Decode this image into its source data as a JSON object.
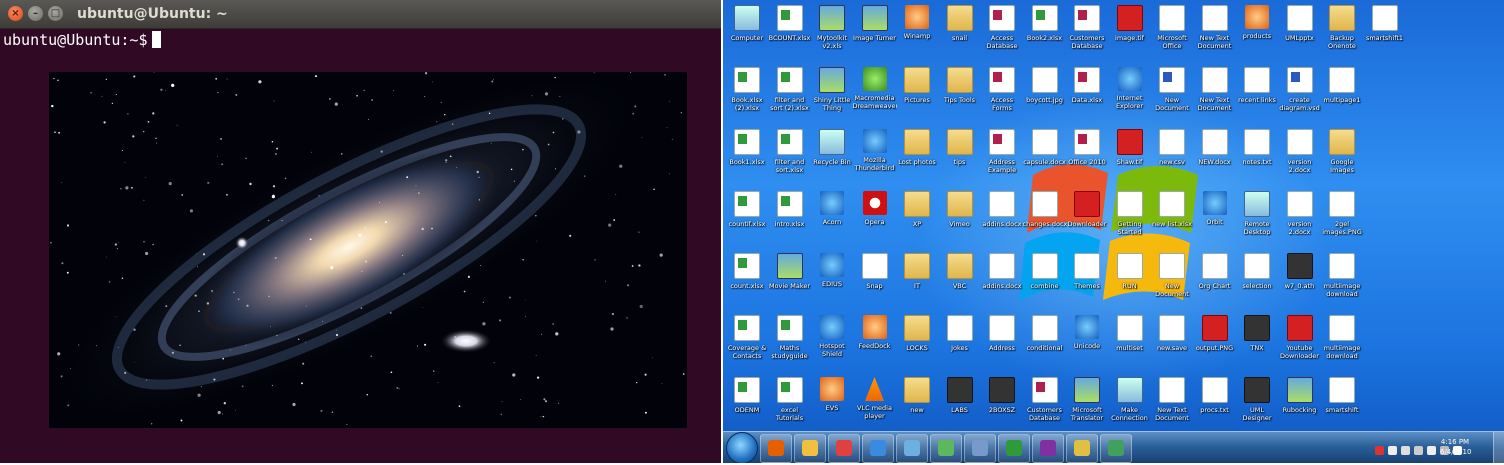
{
  "terminal": {
    "title": "ubuntu@Ubuntu: ~",
    "prompt": "ubuntu@Ubuntu:~$",
    "controls": {
      "close": "×",
      "minimize": "–",
      "maximize": "□"
    }
  },
  "desktop": {
    "icons": [
      {
        "label": "Computer",
        "kind": "g-win"
      },
      {
        "label": "BCOUNT.xlsx",
        "kind": "g-xls"
      },
      {
        "label": "Mytoolkit v2.xls",
        "kind": "g-img"
      },
      {
        "label": "Image Turner",
        "kind": "g-img"
      },
      {
        "label": "Winamp",
        "kind": "g-orange"
      },
      {
        "label": "snail",
        "kind": "g-fold"
      },
      {
        "label": "Access Database",
        "kind": "g-acc"
      },
      {
        "label": "Book2.xlsx",
        "kind": "g-xls"
      },
      {
        "label": "Customers Database",
        "kind": "g-acc"
      },
      {
        "label": "image.tif",
        "kind": "g-red"
      },
      {
        "label": "Microsoft Office",
        "kind": "g-doc"
      },
      {
        "label": "New Text Document",
        "kind": "g-doc"
      },
      {
        "label": "products",
        "kind": "g-orange"
      },
      {
        "label": "UMLpptx",
        "kind": "g-doc"
      },
      {
        "label": "Backup Onenote",
        "kind": "g-fold"
      },
      {
        "label": "smartshift1",
        "kind": "g-doc"
      },
      {
        "label": "Book.xlsx (2).xlsx",
        "kind": "g-xls"
      },
      {
        "label": "filter and sort (2).xlsx",
        "kind": "g-xls"
      },
      {
        "label": "Shiny Little Thing",
        "kind": "g-img"
      },
      {
        "label": "Macromedia Dreamweaver",
        "kind": "g-green"
      },
      {
        "label": "Pictures",
        "kind": "g-fold"
      },
      {
        "label": "Tips Tools",
        "kind": "g-fold"
      },
      {
        "label": "Access Forms",
        "kind": "g-acc"
      },
      {
        "label": "boycott.jpg",
        "kind": "g-doc"
      },
      {
        "label": "Data.xlsx",
        "kind": "g-acc"
      },
      {
        "label": "Internet Explorer",
        "kind": "g-blue"
      },
      {
        "label": "New Document",
        "kind": "g-wrd"
      },
      {
        "label": "New Text Document",
        "kind": "g-doc"
      },
      {
        "label": "recent links",
        "kind": "g-doc"
      },
      {
        "label": "create diagram.vsd",
        "kind": "g-wrd"
      },
      {
        "label": "multipage1",
        "kind": "g-doc"
      },
      {
        "label": "Book1.xlsx",
        "kind": "g-xls"
      },
      {
        "label": "filter and sort.xlsx",
        "kind": "g-xls"
      },
      {
        "label": "Recycle Bin",
        "kind": "g-win"
      },
      {
        "label": "Mozilla Thunderbird",
        "kind": "g-blue"
      },
      {
        "label": "Lost photos",
        "kind": "g-fold"
      },
      {
        "label": "tips",
        "kind": "g-fold"
      },
      {
        "label": "Address Example",
        "kind": "g-acc"
      },
      {
        "label": "capsule.docx",
        "kind": "g-doc"
      },
      {
        "label": "Office 2010",
        "kind": "g-acc"
      },
      {
        "label": "Shaw.tif",
        "kind": "g-red"
      },
      {
        "label": "new.csv",
        "kind": "g-doc"
      },
      {
        "label": "NEW.docx",
        "kind": "g-doc"
      },
      {
        "label": "notes.txt",
        "kind": "g-doc"
      },
      {
        "label": "version 2.docx",
        "kind": "g-doc"
      },
      {
        "label": "Google Images",
        "kind": "g-fold"
      },
      {
        "label": "countif.xlsx",
        "kind": "g-xls"
      },
      {
        "label": "intro.xlsx",
        "kind": "g-xls"
      },
      {
        "label": "Acorn",
        "kind": "g-blue"
      },
      {
        "label": "Opera",
        "kind": "g-opera"
      },
      {
        "label": "XP",
        "kind": "g-fold"
      },
      {
        "label": "Vimeo",
        "kind": "g-fold"
      },
      {
        "label": "addins.docx",
        "kind": "g-doc"
      },
      {
        "label": "changes.docx",
        "kind": "g-doc"
      },
      {
        "label": "Downloader",
        "kind": "g-red"
      },
      {
        "label": "Getting Started",
        "kind": "g-doc"
      },
      {
        "label": "new list.xlsx",
        "kind": "g-doc"
      },
      {
        "label": "Orbit",
        "kind": "g-blue"
      },
      {
        "label": "Remote Desktop",
        "kind": "g-win"
      },
      {
        "label": "version 2.docx",
        "kind": "g-doc"
      },
      {
        "label": "2gel images.PNG",
        "kind": "g-doc"
      },
      {
        "label": "count.xlsx",
        "kind": "g-xls"
      },
      {
        "label": "Movie Maker",
        "kind": "g-img"
      },
      {
        "label": "EDIUS",
        "kind": "g-blue"
      },
      {
        "label": "Snap",
        "kind": "g-doc"
      },
      {
        "label": "IT",
        "kind": "g-fold"
      },
      {
        "label": "VBC",
        "kind": "g-fold"
      },
      {
        "label": "addins.docx",
        "kind": "g-doc"
      },
      {
        "label": "combine",
        "kind": "g-doc"
      },
      {
        "label": "Themes",
        "kind": "g-doc"
      },
      {
        "label": "RUN",
        "kind": "g-doc"
      },
      {
        "label": "New Document",
        "kind": "g-doc"
      },
      {
        "label": "Org Chart",
        "kind": "g-doc"
      },
      {
        "label": "selection",
        "kind": "g-doc"
      },
      {
        "label": "w7_0.ath",
        "kind": "g-dark"
      },
      {
        "label": "multiimage download",
        "kind": "g-doc"
      },
      {
        "label": "Coverage & Contacts",
        "kind": "g-xls"
      },
      {
        "label": "Maths studyguide",
        "kind": "g-xls"
      },
      {
        "label": "Hotspot Shield",
        "kind": "g-blue"
      },
      {
        "label": "FeedDock",
        "kind": "g-orange"
      },
      {
        "label": "LOCKS",
        "kind": "g-fold"
      },
      {
        "label": "Jokes",
        "kind": "g-doc"
      },
      {
        "label": "Address",
        "kind": "g-doc"
      },
      {
        "label": "conditional",
        "kind": "g-doc"
      },
      {
        "label": "Unicode",
        "kind": "g-blue"
      },
      {
        "label": "multiset",
        "kind": "g-doc"
      },
      {
        "label": "new.save",
        "kind": "g-doc"
      },
      {
        "label": "output.PNG",
        "kind": "g-red"
      },
      {
        "label": "TNX",
        "kind": "g-dark"
      },
      {
        "label": "Youtube Downloader",
        "kind": "g-red"
      },
      {
        "label": "multiimage download",
        "kind": "g-doc"
      },
      {
        "label": "ODENM",
        "kind": "g-xls"
      },
      {
        "label": "excel Tutorials",
        "kind": "g-xls"
      },
      {
        "label": "EVS",
        "kind": "g-orange"
      },
      {
        "label": "VLC media player",
        "kind": "g-cone"
      },
      {
        "label": "new",
        "kind": "g-fold"
      },
      {
        "label": "LABS",
        "kind": "g-dark"
      },
      {
        "label": "2BOXSZ",
        "kind": "g-dark"
      },
      {
        "label": "Customers Database",
        "kind": "g-acc"
      },
      {
        "label": "Microsoft Translator",
        "kind": "g-img"
      },
      {
        "label": "Make Connection",
        "kind": "g-win"
      },
      {
        "label": "New Text Document",
        "kind": "g-doc"
      },
      {
        "label": "procs.txt",
        "kind": "g-doc"
      },
      {
        "label": "UML Designer",
        "kind": "g-dark"
      },
      {
        "label": "Rubocking",
        "kind": "g-img"
      },
      {
        "label": "smartshift",
        "kind": "g-doc"
      }
    ],
    "taskbar": {
      "start": "start-orb",
      "pinned": [
        {
          "name": "firefox",
          "color": "#e66000"
        },
        {
          "name": "explorer",
          "color": "#f0c040"
        },
        {
          "name": "paint",
          "color": "#e04040"
        },
        {
          "name": "ie",
          "color": "#3a8ae0"
        },
        {
          "name": "mail",
          "color": "#6bb0e0"
        },
        {
          "name": "messenger",
          "color": "#5cb85c"
        },
        {
          "name": "network",
          "color": "#7799cc"
        },
        {
          "name": "excel",
          "color": "#2e9a3a"
        },
        {
          "name": "onenote",
          "color": "#8030a0"
        },
        {
          "name": "word",
          "color": "#e0c040"
        },
        {
          "name": "app",
          "color": "#40a060"
        }
      ],
      "clock_time": "4:16 PM",
      "clock_date": "6/4/2010"
    }
  }
}
